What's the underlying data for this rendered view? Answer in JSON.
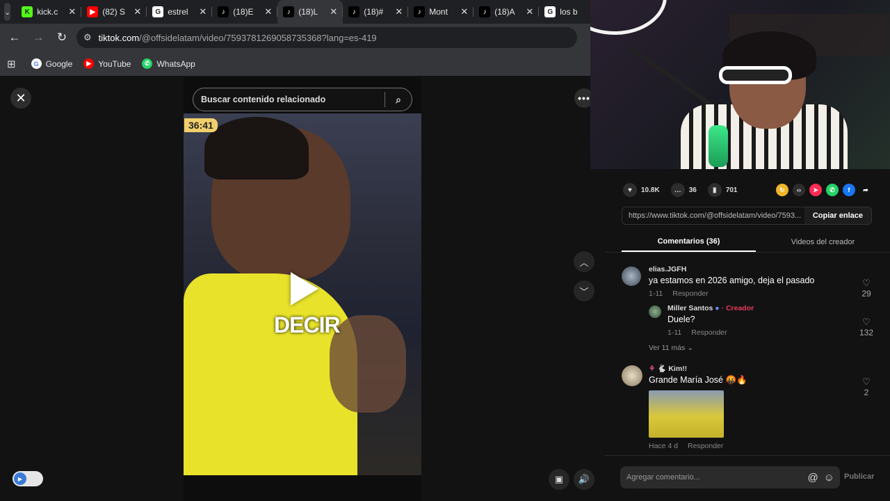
{
  "browser": {
    "tabs": [
      {
        "title": "kick.c",
        "favicon": "kick-icon",
        "color": "#53fc18",
        "glyph": "K",
        "active": false
      },
      {
        "title": "(82) S",
        "favicon": "youtube-icon",
        "color": "#ff0000",
        "glyph": "▶",
        "active": false
      },
      {
        "title": "estrel",
        "favicon": "google-icon",
        "color": "#ffffff",
        "glyph": "G",
        "active": false
      },
      {
        "title": "(18)E",
        "favicon": "tiktok-icon",
        "color": "#000000",
        "glyph": "♪",
        "active": false
      },
      {
        "title": "(18)L",
        "favicon": "tiktok-icon",
        "color": "#000000",
        "glyph": "♪",
        "active": true
      },
      {
        "title": "(18)#",
        "favicon": "tiktok-icon",
        "color": "#000000",
        "glyph": "♪",
        "active": false
      },
      {
        "title": "Mont",
        "favicon": "tiktok-icon",
        "color": "#000000",
        "glyph": "♪",
        "active": false
      },
      {
        "title": "(18)A",
        "favicon": "tiktok-icon",
        "color": "#000000",
        "glyph": "♪",
        "active": false
      },
      {
        "title": "los b",
        "favicon": "google-icon",
        "color": "#ffffff",
        "glyph": "G",
        "active": false
      }
    ],
    "url_host": "tiktok.com",
    "url_path": "/@offsidelatam/video/7593781269058735368?lang=es-419",
    "bookmarks": [
      {
        "label": "Google",
        "icon": "google-icon",
        "color": "#ffffff",
        "glyph": "G"
      },
      {
        "label": "YouTube",
        "icon": "youtube-icon",
        "color": "#ff0000",
        "glyph": "▶"
      },
      {
        "label": "WhatsApp",
        "icon": "whatsapp-icon",
        "color": "#25d366",
        "glyph": "✆"
      }
    ]
  },
  "video": {
    "search_placeholder": "Buscar contenido relacionado",
    "timer": "36:41",
    "overlay_text": "DECIR"
  },
  "stats": {
    "likes": "10.8K",
    "comments": "36",
    "saves": "701"
  },
  "share_link": {
    "url": "https://www.tiktok.com/@offsidelatam/video/7593...",
    "copy_label": "Copiar enlace"
  },
  "panel_tabs": {
    "comments": "Comentarios (36)",
    "creator_videos": "Videos del creador"
  },
  "comments": [
    {
      "user": "elias.JGFH",
      "text": "ya estamos en 2026 amigo, deja el pasado",
      "date": "1-11",
      "reply_label": "Responder",
      "likes": "29"
    },
    {
      "user": "Miller Santos",
      "creator_tag": "· Creador",
      "text": "Duele?",
      "date": "1-11",
      "reply_label": "Responder",
      "likes": "132"
    },
    {
      "user": "Kim!!",
      "text": "Grande María José 🤬🔥",
      "date": "Hace 4 d",
      "reply_label": "Responder",
      "likes": "2"
    }
  ],
  "more_replies": "Ver 11 más",
  "composer": {
    "placeholder": "Agregar comentario...",
    "publish_label": "Publicar"
  },
  "colors": {
    "accent_creator": "#e63a5c",
    "video_timer": "#f2cf6c"
  }
}
